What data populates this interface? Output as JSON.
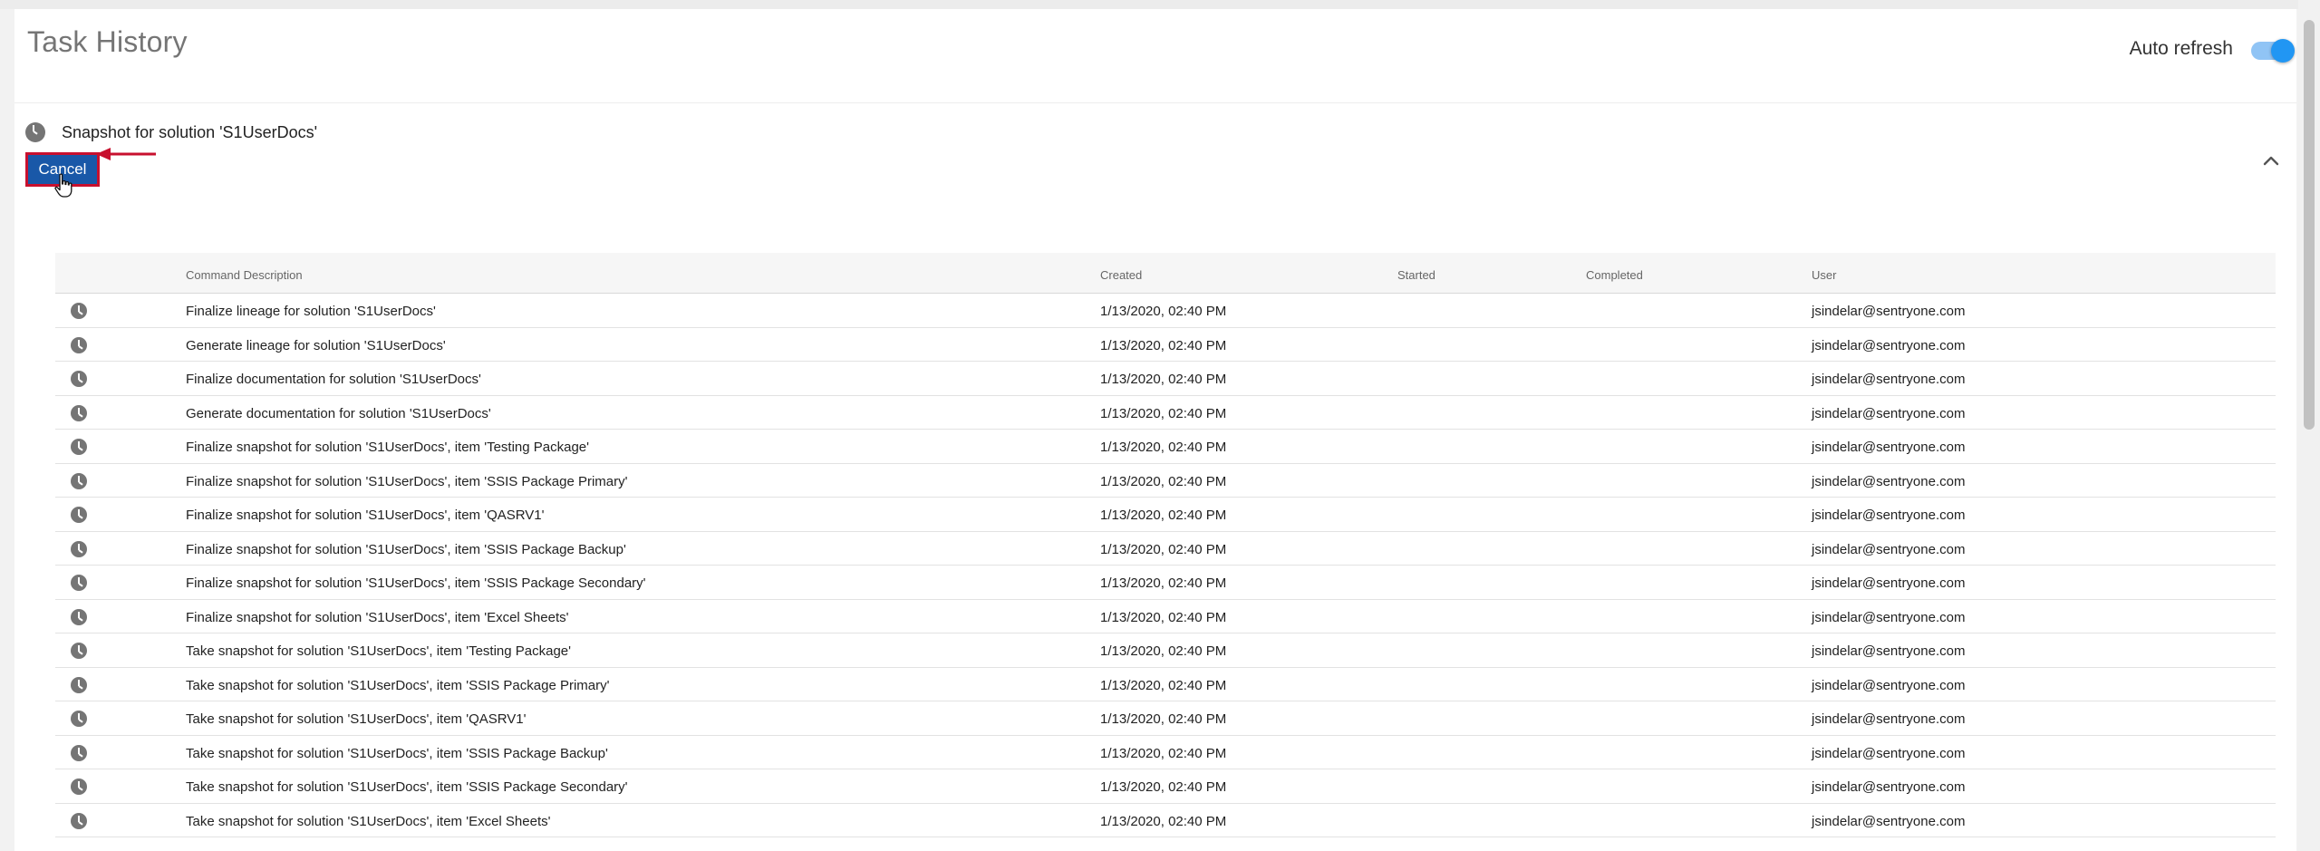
{
  "header": {
    "title": "Task History",
    "auto_refresh_label": "Auto refresh",
    "auto_refresh_on": true,
    "toggle_color": "#2196f3"
  },
  "task": {
    "title": "Snapshot for solution 'S1UserDocs'",
    "icon": "clock-icon",
    "cancel_label": "Cancel",
    "cancel_color": "#1958a8",
    "highlight_color": "#c8102e"
  },
  "table": {
    "columns": [
      "Command Description",
      "Created",
      "Started",
      "Completed",
      "User"
    ],
    "rows": [
      {
        "description": "Finalize lineage for solution 'S1UserDocs'",
        "created": "1/13/2020, 02:40 PM",
        "started": "",
        "completed": "",
        "user": "jsindelar@sentryone.com"
      },
      {
        "description": "Generate lineage for solution 'S1UserDocs'",
        "created": "1/13/2020, 02:40 PM",
        "started": "",
        "completed": "",
        "user": "jsindelar@sentryone.com"
      },
      {
        "description": "Finalize documentation for solution 'S1UserDocs'",
        "created": "1/13/2020, 02:40 PM",
        "started": "",
        "completed": "",
        "user": "jsindelar@sentryone.com"
      },
      {
        "description": "Generate documentation for solution 'S1UserDocs'",
        "created": "1/13/2020, 02:40 PM",
        "started": "",
        "completed": "",
        "user": "jsindelar@sentryone.com"
      },
      {
        "description": "Finalize snapshot for solution 'S1UserDocs', item 'Testing Package'",
        "created": "1/13/2020, 02:40 PM",
        "started": "",
        "completed": "",
        "user": "jsindelar@sentryone.com"
      },
      {
        "description": "Finalize snapshot for solution 'S1UserDocs', item 'SSIS Package Primary'",
        "created": "1/13/2020, 02:40 PM",
        "started": "",
        "completed": "",
        "user": "jsindelar@sentryone.com"
      },
      {
        "description": "Finalize snapshot for solution 'S1UserDocs', item 'QASRV1'",
        "created": "1/13/2020, 02:40 PM",
        "started": "",
        "completed": "",
        "user": "jsindelar@sentryone.com"
      },
      {
        "description": "Finalize snapshot for solution 'S1UserDocs', item 'SSIS Package Backup'",
        "created": "1/13/2020, 02:40 PM",
        "started": "",
        "completed": "",
        "user": "jsindelar@sentryone.com"
      },
      {
        "description": "Finalize snapshot for solution 'S1UserDocs', item 'SSIS Package Secondary'",
        "created": "1/13/2020, 02:40 PM",
        "started": "",
        "completed": "",
        "user": "jsindelar@sentryone.com"
      },
      {
        "description": "Finalize snapshot for solution 'S1UserDocs', item 'Excel Sheets'",
        "created": "1/13/2020, 02:40 PM",
        "started": "",
        "completed": "",
        "user": "jsindelar@sentryone.com"
      },
      {
        "description": "Take snapshot for solution 'S1UserDocs', item 'Testing Package'",
        "created": "1/13/2020, 02:40 PM",
        "started": "",
        "completed": "",
        "user": "jsindelar@sentryone.com"
      },
      {
        "description": "Take snapshot for solution 'S1UserDocs', item 'SSIS Package Primary'",
        "created": "1/13/2020, 02:40 PM",
        "started": "",
        "completed": "",
        "user": "jsindelar@sentryone.com"
      },
      {
        "description": "Take snapshot for solution 'S1UserDocs', item 'QASRV1'",
        "created": "1/13/2020, 02:40 PM",
        "started": "",
        "completed": "",
        "user": "jsindelar@sentryone.com"
      },
      {
        "description": "Take snapshot for solution 'S1UserDocs', item 'SSIS Package Backup'",
        "created": "1/13/2020, 02:40 PM",
        "started": "",
        "completed": "",
        "user": "jsindelar@sentryone.com"
      },
      {
        "description": "Take snapshot for solution 'S1UserDocs', item 'SSIS Package Secondary'",
        "created": "1/13/2020, 02:40 PM",
        "started": "",
        "completed": "",
        "user": "jsindelar@sentryone.com"
      },
      {
        "description": "Take snapshot for solution 'S1UserDocs', item 'Excel Sheets'",
        "created": "1/13/2020, 02:40 PM",
        "started": "",
        "completed": "",
        "user": "jsindelar@sentryone.com"
      }
    ]
  },
  "icons": {
    "row_status": "clock-icon",
    "collapse": "chevron-up-icon",
    "annotation": "red-arrow-icon",
    "pointer": "hand-cursor-icon"
  }
}
